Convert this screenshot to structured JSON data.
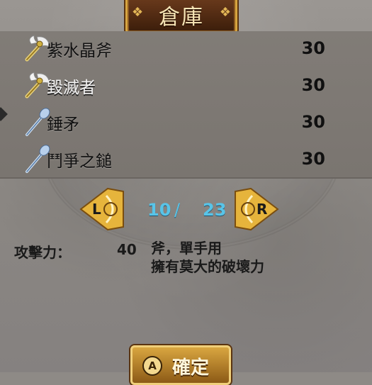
{
  "header": {
    "title": "倉庫"
  },
  "items": [
    {
      "name": "紫水晶斧",
      "qty": "30",
      "icon": "golden-axe-icon",
      "selected": false
    },
    {
      "name": "毀滅者",
      "qty": "30",
      "icon": "golden-axe-icon",
      "selected": true
    },
    {
      "name": "錘矛",
      "qty": "30",
      "icon": "blue-mace-icon",
      "selected": false
    },
    {
      "name": "鬥爭之鎚",
      "qty": "30",
      "icon": "blue-mace-icon",
      "selected": false
    }
  ],
  "pager": {
    "left_button": "L",
    "right_button": "R",
    "current": "10",
    "separator": "/",
    "total": "23"
  },
  "stats": {
    "attack_label": "攻擊力：",
    "attack_value": "40",
    "description_line1": "斧，單手用",
    "description_line2": "擁有莫大的破壞力"
  },
  "confirm": {
    "button_glyph": "A",
    "label": "確定"
  },
  "colors": {
    "gold": "#d7a53f",
    "page_number": "#58c4e8",
    "plaque": "#3b1d0a"
  }
}
